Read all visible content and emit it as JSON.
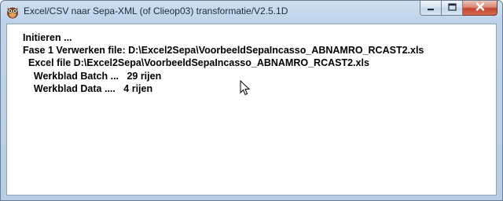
{
  "window": {
    "title": "Excel/CSV naar Sepa-XML (of Clieop03) transformatie/V2.5.1D",
    "icons": {
      "app": "owl-app-icon",
      "minimize": "minimize-icon",
      "maximize": "maximize-icon",
      "close": "close-icon"
    },
    "colors": {
      "titlebar": "#bcd3ea",
      "close_button": "#c4452d",
      "text": "#000000"
    }
  },
  "log": {
    "lines": [
      "Initieren ...",
      "Fase 1 Verwerken file: D:\\Excel2Sepa\\VoorbeeldSepaIncasso_ABNAMRO_RCAST2.xls",
      "  Excel file D:\\Excel2Sepa\\VoorbeeldSepaIncasso_ABNAMRO_RCAST2.xls",
      "    Werkblad Batch ...   29 rijen",
      "    Werkblad Data ....   4 rijen"
    ]
  },
  "pointer": {
    "icon": "mouse-pointer-icon"
  }
}
